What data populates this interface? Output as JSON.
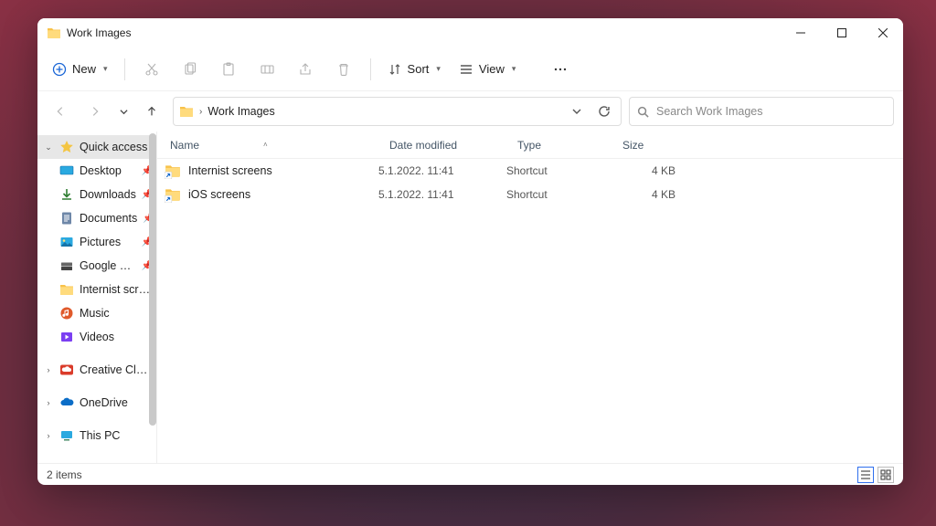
{
  "window": {
    "title": "Work Images"
  },
  "toolbar": {
    "new_label": "New",
    "sort_label": "Sort",
    "view_label": "View"
  },
  "breadcrumb": {
    "current": "Work Images"
  },
  "search": {
    "placeholder": "Search Work Images"
  },
  "columns": {
    "name": "Name",
    "modified": "Date modified",
    "type": "Type",
    "size": "Size"
  },
  "sidebar": {
    "quick_access": "Quick access",
    "items": [
      {
        "label": "Desktop",
        "icon": "desktop",
        "pinned": true
      },
      {
        "label": "Downloads",
        "icon": "download",
        "pinned": true
      },
      {
        "label": "Documents",
        "icon": "document",
        "pinned": true
      },
      {
        "label": "Pictures",
        "icon": "pictures",
        "pinned": true
      },
      {
        "label": "Google Drive",
        "icon": "gdrive",
        "pinned": true
      },
      {
        "label": "Internist screens",
        "icon": "folder",
        "pinned": false
      },
      {
        "label": "Music",
        "icon": "music",
        "pinned": false
      },
      {
        "label": "Videos",
        "icon": "videos",
        "pinned": false
      }
    ],
    "creative_cloud": "Creative Cloud Fi",
    "onedrive": "OneDrive",
    "this_pc": "This PC"
  },
  "files": [
    {
      "name": "Internist screens",
      "modified": "5.1.2022. 11:41",
      "type": "Shortcut",
      "size": "4 KB"
    },
    {
      "name": "iOS screens",
      "modified": "5.1.2022. 11:41",
      "type": "Shortcut",
      "size": "4 KB"
    }
  ],
  "status": {
    "item_count": "2 items"
  }
}
